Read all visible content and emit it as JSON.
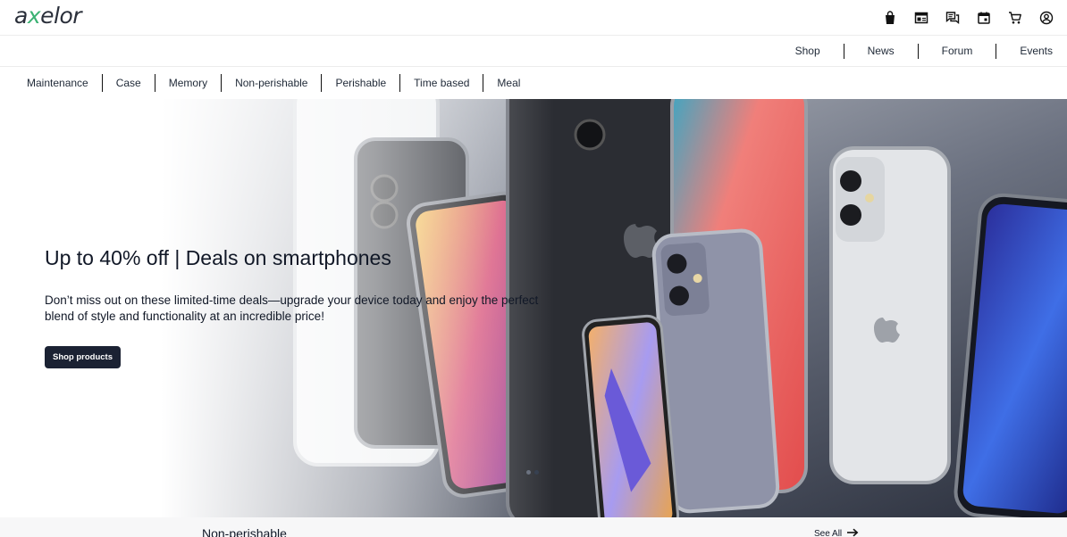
{
  "brand": {
    "logo_left": "a",
    "logo_x": "x",
    "logo_right": "elor",
    "accent_color": "#3bb273"
  },
  "header_icons": [
    "shopping-bag-icon",
    "dashboard-icon",
    "chat-icon",
    "calendar-icon",
    "cart-icon",
    "account-icon"
  ],
  "primary_nav": {
    "items": [
      "Shop",
      "News",
      "Forum",
      "Events"
    ]
  },
  "categories": {
    "items": [
      "Maintenance",
      "Case",
      "Memory",
      "Non-perishable",
      "Perishable",
      "Time based",
      "Meal"
    ]
  },
  "hero": {
    "title": "Up to 40% off | Deals on smartphones",
    "subtitle": "Don’t miss out on these limited-time deals—upgrade your device today and enjoy the perfect blend of style and functionality at an incredible price!",
    "button_label": "Shop products",
    "button_color": "#1b2233",
    "slide_count": 2,
    "active_slide": 2
  },
  "section": {
    "title": "Non-perishable",
    "see_all_label": "See All"
  }
}
